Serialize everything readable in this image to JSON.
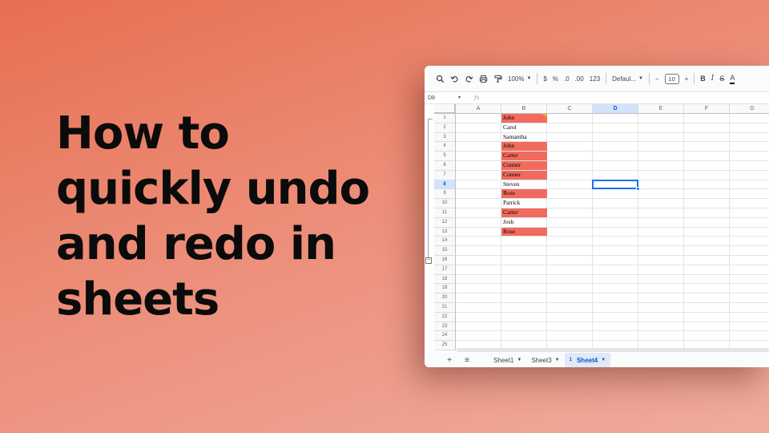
{
  "headline": {
    "lines": [
      "How to",
      "quickly undo",
      "and redo in",
      "sheets"
    ]
  },
  "spreadsheet": {
    "toolbar": {
      "icons": [
        "search-icon",
        "undo-icon",
        "redo-icon",
        "print-icon",
        "paint-format-icon"
      ],
      "zoom": "100%",
      "currency": "$",
      "percent": "%",
      "decrease_decimal": ".0",
      "increase_decimal": ".00",
      "more_formats": "123",
      "font": "Defaul...",
      "font_size_minus": "−",
      "font_size": "10",
      "font_size_plus": "+",
      "bold": "B",
      "italic": "I",
      "strikethrough": "S",
      "text_color": "A"
    },
    "formula_bar": {
      "name_box": "D8",
      "fx": "fx"
    },
    "columns": [
      "A",
      "B",
      "C",
      "D",
      "E",
      "F",
      "G"
    ],
    "active_column": "D",
    "rows": [
      "1",
      "2",
      "3",
      "4",
      "5",
      "6",
      "7",
      "8",
      "9",
      "10",
      "11",
      "12",
      "13",
      "14",
      "15",
      "16",
      "17",
      "18",
      "19",
      "20",
      "21",
      "22",
      "23",
      "24",
      "25"
    ],
    "active_row": "8",
    "column_b": [
      {
        "value": "John",
        "highlight": true,
        "note": true
      },
      {
        "value": "Carol",
        "highlight": false
      },
      {
        "value": "Samantha",
        "highlight": false
      },
      {
        "value": "John",
        "highlight": true
      },
      {
        "value": "Carter",
        "highlight": true
      },
      {
        "value": "Conner",
        "highlight": true
      },
      {
        "value": "Conner",
        "highlight": true
      },
      {
        "value": "Steven",
        "highlight": false
      },
      {
        "value": "Rose",
        "highlight": true
      },
      {
        "value": "Patrick",
        "highlight": false
      },
      {
        "value": "Carter",
        "highlight": true
      },
      {
        "value": "Josh",
        "highlight": false
      },
      {
        "value": "Rose",
        "highlight": true
      }
    ],
    "highlight_color": "#f06b5d",
    "selection_color": "#1a73e8",
    "sheet_tabs": {
      "add": "+",
      "all_sheets": "≡",
      "tabs": [
        {
          "label": "Sheet1",
          "active": false
        },
        {
          "label": "Sheet3",
          "active": false
        },
        {
          "label": "Sheet4",
          "active": true,
          "badge": "1"
        }
      ]
    }
  }
}
